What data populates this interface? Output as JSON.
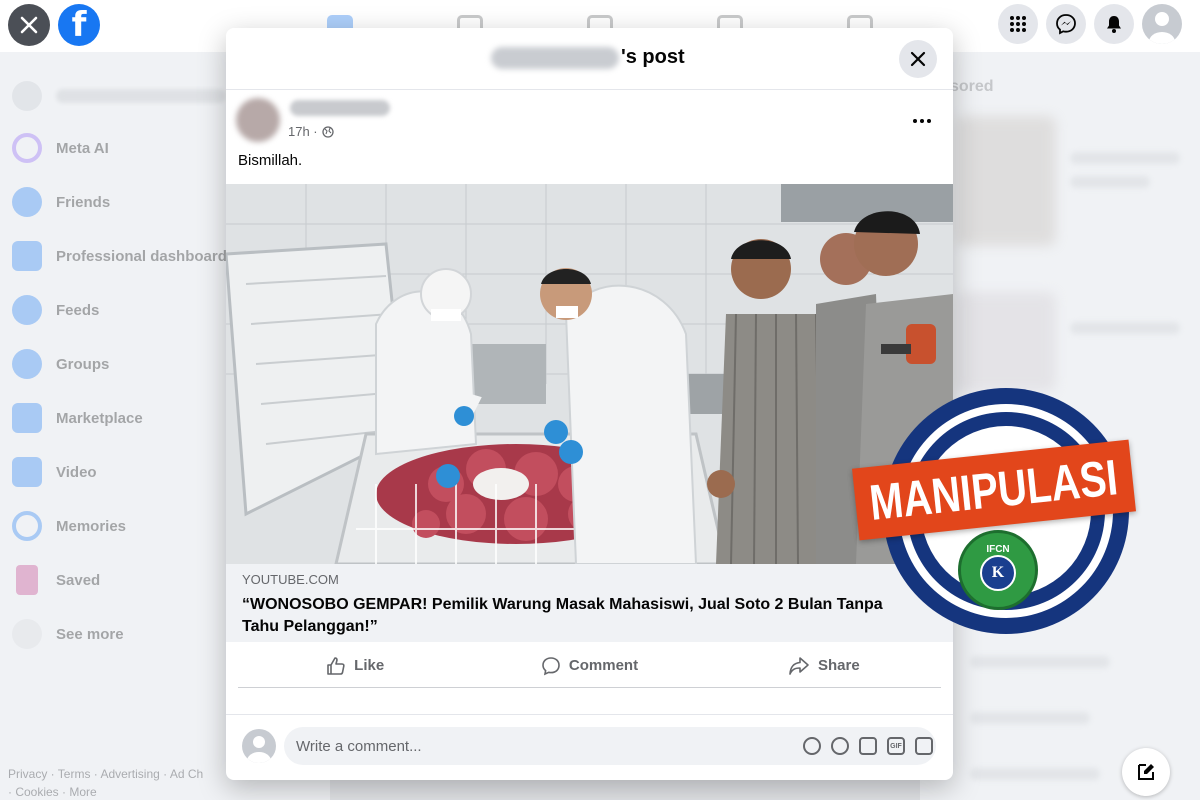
{
  "topbar": {
    "logo_letter": "f",
    "close_icon": "close-icon",
    "right_icons": [
      "menu-grid-icon",
      "messenger-icon",
      "bell-icon",
      "profile-avatar"
    ]
  },
  "sidebar": {
    "items": [
      {
        "label": "Meta AI",
        "icon": "meta-ai-icon",
        "color": "#8a5cf6"
      },
      {
        "label": "Friends",
        "icon": "friends-icon",
        "color": "#1877f2"
      },
      {
        "label": "Professional dashboard",
        "icon": "dashboard-icon",
        "color": "#1877f2"
      },
      {
        "label": "Feeds",
        "icon": "feeds-icon",
        "color": "#1877f2"
      },
      {
        "label": "Groups",
        "icon": "groups-icon",
        "color": "#1877f2"
      },
      {
        "label": "Marketplace",
        "icon": "marketplace-icon",
        "color": "#1877f2"
      },
      {
        "label": "Video",
        "icon": "video-icon",
        "color": "#1877f2"
      },
      {
        "label": "Memories",
        "icon": "memories-icon",
        "color": "#1877f2"
      },
      {
        "label": "Saved",
        "icon": "saved-icon",
        "color": "#c13584"
      },
      {
        "label": "See more",
        "icon": "chevron-down-icon",
        "color": "#e4e6eb"
      }
    ],
    "footer_line1": "Privacy · Terms · Advertising · Ad Ch",
    "footer_line2": "· Cookies · More"
  },
  "right_column": {
    "sponsored_label": "sored"
  },
  "modal": {
    "title_suffix": "'s post",
    "post": {
      "time": "17h ·",
      "text": "Bismillah.",
      "link_domain": "YOUTUBE.COM",
      "link_title": "“WONOSOBO GEMPAR! Pemilik Warung Masak Mahasiswi, Jual Soto 2 Bulan Tanpa Tahu Pelanggan!”"
    },
    "actions": {
      "like": "Like",
      "comment": "Comment",
      "share": "Share"
    },
    "comment": {
      "placeholder": "Write a comment...",
      "gif_label": "GIF"
    }
  },
  "stamp": {
    "text": "MANIPULASI",
    "seal_top": "IFCN",
    "seal_badge": "K",
    "colors": {
      "ring": "#15357e",
      "banner": "#e2461b",
      "seal": "#2f9a43"
    }
  },
  "colors": {
    "facebook_blue": "#1877f2",
    "background": "#f0f2f5",
    "text_secondary": "#65676b"
  }
}
